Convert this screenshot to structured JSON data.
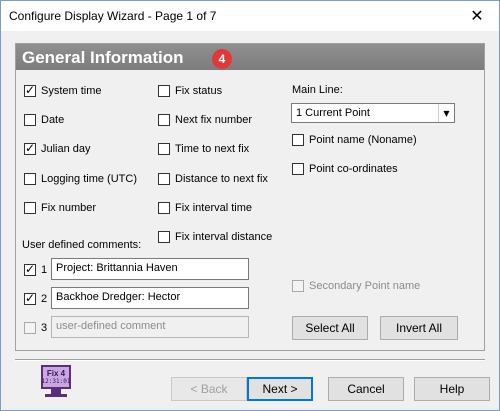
{
  "window": {
    "title": "Configure Display Wizard - Page 1 of 7",
    "close_glyph": "✕"
  },
  "panel": {
    "title": "General Information",
    "badge": "4"
  },
  "left_checks": [
    {
      "label": "System time",
      "checked": true
    },
    {
      "label": "Date",
      "checked": false
    },
    {
      "label": "Julian day",
      "checked": true
    },
    {
      "label": "Logging time (UTC)",
      "checked": false
    },
    {
      "label": "Fix number",
      "checked": false
    }
  ],
  "middle_checks": [
    {
      "label": "Fix status",
      "checked": false
    },
    {
      "label": "Next fix number",
      "checked": false
    },
    {
      "label": "Time to next fix",
      "checked": false
    },
    {
      "label": "Distance to next fix",
      "checked": false
    },
    {
      "label": "Fix interval time",
      "checked": false
    },
    {
      "label": "Fix interval distance",
      "checked": false
    }
  ],
  "main_line": {
    "label": "Main Line:",
    "selected": "1  Current Point",
    "point_name": {
      "label": "Point name (Noname)",
      "checked": false
    },
    "point_coords": {
      "label": "Point co-ordinates",
      "checked": false
    }
  },
  "secondary_point": {
    "label": "Secondary Point name",
    "checked": false,
    "disabled": true
  },
  "comments": {
    "label": "User defined comments:",
    "rows": [
      {
        "number": "1",
        "checked": true,
        "value": "Project: Brittannia Haven",
        "disabled": false
      },
      {
        "number": "2",
        "checked": true,
        "value": "Backhoe Dredger: Hector",
        "disabled": false
      },
      {
        "number": "3",
        "checked": false,
        "value": "user-defined comment",
        "disabled": true
      }
    ]
  },
  "buttons": {
    "select_all": "Select All",
    "invert_all": "Invert All",
    "back": "< Back",
    "next": "Next >",
    "cancel": "Cancel",
    "help": "Help"
  },
  "logo": {
    "line1": "Fix 4",
    "line2": "12:31:01"
  },
  "colors": {
    "header_bg": "#808080",
    "badge": "#e03838",
    "default_border": "#0078d7"
  }
}
